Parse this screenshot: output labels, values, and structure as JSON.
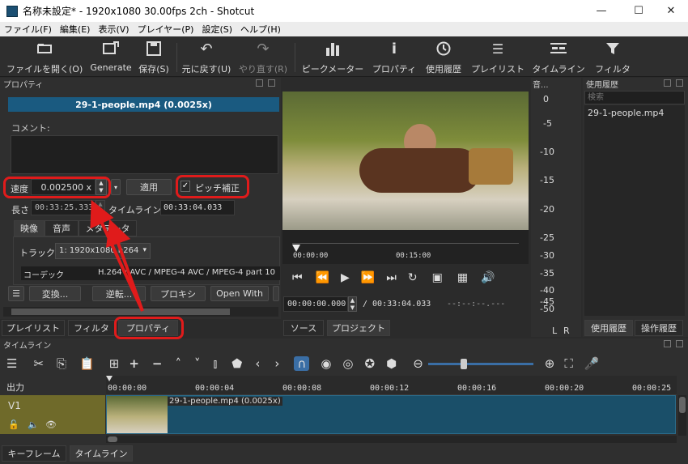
{
  "window": {
    "title": "名称未設定* - 1920x1080 30.00fps 2ch - Shotcut"
  },
  "menu": [
    "ファイル(F)",
    "編集(E)",
    "表示(V)",
    "プレイヤー(P)",
    "設定(S)",
    "ヘルプ(H)"
  ],
  "toolbar": {
    "open": "ファイルを開く(O)",
    "generate": "Generate",
    "save": "保存(S)",
    "undo": "元に戻す(U)",
    "redo": "やり直す(R)",
    "peak": "ピークメーター",
    "properties": "プロパティ",
    "history": "使用履歴",
    "playlist": "プレイリスト",
    "timeline": "タイムライン",
    "filter": "フィルタ"
  },
  "properties": {
    "panel_title": "プロパティ",
    "clip_name": "29-1-people.mp4 (0.0025x)",
    "comment_label": "コメント:",
    "speed_label": "速度",
    "speed_value": "0.002500 x",
    "apply": "適用",
    "pitch_label": "ピッチ補正",
    "length_label": "長さ",
    "length_value": "00:33:25.333",
    "timeline_label": "タイムライン",
    "timeline_value": "00:33:04.033",
    "tabs": [
      "映像",
      "音声",
      "メタデータ"
    ],
    "track_label": "トラック",
    "track_value": "1: 1920x1080 h264",
    "codec_label": "コーデック",
    "codec_value": "H.264 / AVC / MPEG-4 AVC / MPEG-4 part 10",
    "actions": [
      "変換...",
      "逆転...",
      "プロキシ",
      "Open With"
    ]
  },
  "left_tabs": [
    "プレイリスト",
    "フィルタ",
    "プロパティ"
  ],
  "player": {
    "ruler": [
      "00:00:00",
      "00:15:00"
    ],
    "current_time": "00:00:00.000",
    "total_time": "/ 00:33:04.033",
    "in_out": "--:--:--.---",
    "tabs": [
      "ソース",
      "プロジェクト"
    ]
  },
  "meter": {
    "title": "音...",
    "scale": [
      "0",
      "-5",
      "-10",
      "-15",
      "-20",
      "-25",
      "-30",
      "-35",
      "-40",
      "-45",
      "-50"
    ],
    "lr": [
      "L",
      "R"
    ]
  },
  "history": {
    "title": "使用履歴",
    "search_placeholder": "検索",
    "items": [
      "29-1-people.mp4"
    ],
    "tabs": [
      "使用履歴",
      "操作履歴"
    ]
  },
  "timeline": {
    "title": "タイムライン",
    "output_label": "出力",
    "ticks": [
      "00:00:00",
      "00:00:04",
      "00:00:08",
      "00:00:12",
      "00:00:16",
      "00:00:20",
      "00:00:25"
    ],
    "track_name": "V1",
    "clip_label": "29-1-people.mp4 (0.0025x)",
    "bottom_tabs": [
      "キーフレーム",
      "タイムライン"
    ]
  },
  "colors": {
    "accent": "#1a5a80",
    "highlight": "#e01b1b",
    "clip": "#1a4f69",
    "track_header": "#6f6a2a"
  }
}
